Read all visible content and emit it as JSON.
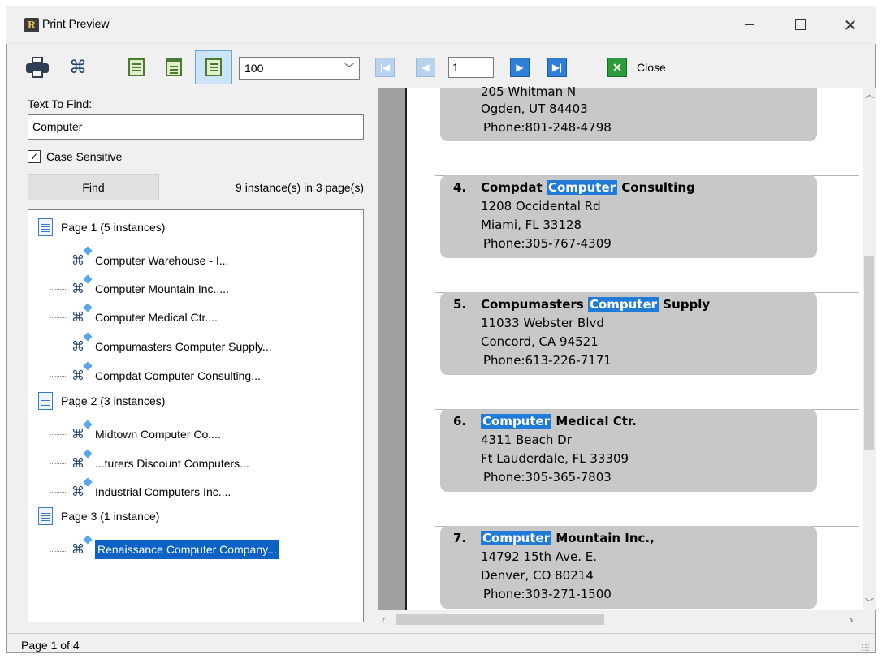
{
  "window": {
    "title": "Print Preview"
  },
  "toolbar": {
    "zoom_value": "100",
    "page_input": "1",
    "close_label": "Close"
  },
  "find": {
    "label": "Text To Find:",
    "query": "Computer",
    "case_sensitive_label": "Case Sensitive",
    "case_sensitive": true,
    "find_label": "Find",
    "summary": "9 instance(s) in 3 page(s)"
  },
  "results": [
    {
      "page_label": "Page 1 (5 instances)",
      "items": [
        "Computer Warehouse - I...",
        "Computer Mountain Inc.,...",
        "Computer Medical Ctr....",
        "Compumasters Computer Supply...",
        "Compdat Computer Consulting..."
      ]
    },
    {
      "page_label": "Page 2 (3 instances)",
      "items": [
        "Midtown Computer Co....",
        "...turers Discount Computers...",
        "Industrial Computers Inc...."
      ]
    },
    {
      "page_label": "Page 3 (1 instance)",
      "items": [
        "Renaissance Computer Company..."
      ]
    }
  ],
  "preview": {
    "partial_card": {
      "line1": "205 Whitman N",
      "line2": "Ogden, UT 84403",
      "phone": "Phone:801-248-4798"
    },
    "cards": [
      {
        "num": "4.",
        "pre": "Compdat ",
        "hl": "Computer",
        "post": " Consulting",
        "addr1": "1208 Occidental Rd",
        "addr2": "Miami, FL 33128",
        "phone": "Phone:305-767-4309"
      },
      {
        "num": "5.",
        "pre": "Compumasters ",
        "hl": "Computer",
        "post": " Supply",
        "addr1": "11033 Webster Blvd",
        "addr2": "Concord, CA 94521",
        "phone": "Phone:613-226-7171"
      },
      {
        "num": "6.",
        "pre": "",
        "hl": "Computer",
        "post": " Medical Ctr.",
        "addr1": "4311 Beach Dr",
        "addr2": "Ft Lauderdale, FL 33309",
        "phone": "Phone:305-365-7803"
      },
      {
        "num": "7.",
        "pre": "",
        "hl": "Computer",
        "post": " Mountain Inc.,",
        "addr1": "14792 15th Ave. E.",
        "addr2": "Denver, CO 80214",
        "phone": "Phone:303-271-1500"
      }
    ]
  },
  "status": {
    "text": "Page 1 of 4"
  }
}
